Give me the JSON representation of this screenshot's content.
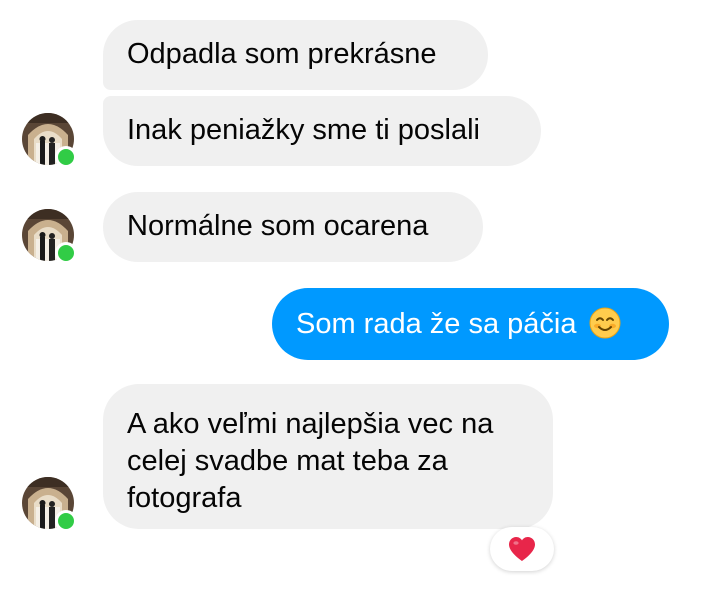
{
  "messages": [
    {
      "id": "m1",
      "direction": "incoming",
      "text": "Odpadla som prekrásne"
    },
    {
      "id": "m2",
      "direction": "incoming",
      "text": "Inak peniažky sme ti poslali"
    },
    {
      "id": "m3",
      "direction": "incoming",
      "text": "Normálne som ocarena"
    },
    {
      "id": "m4",
      "direction": "outgoing",
      "text": "Som rada že sa páčia",
      "emoji": "smiling-face-icon"
    },
    {
      "id": "m5",
      "direction": "incoming",
      "text": "A ako veľmi najlepšia vec na celej svadbe mat teba za fotografa",
      "reaction": "red-heart-icon"
    }
  ],
  "colors": {
    "incoming_bubble": "#f0f0f0",
    "outgoing_bubble": "#0099ff",
    "online_dot": "#31cc46",
    "heart": "#e8264a"
  }
}
